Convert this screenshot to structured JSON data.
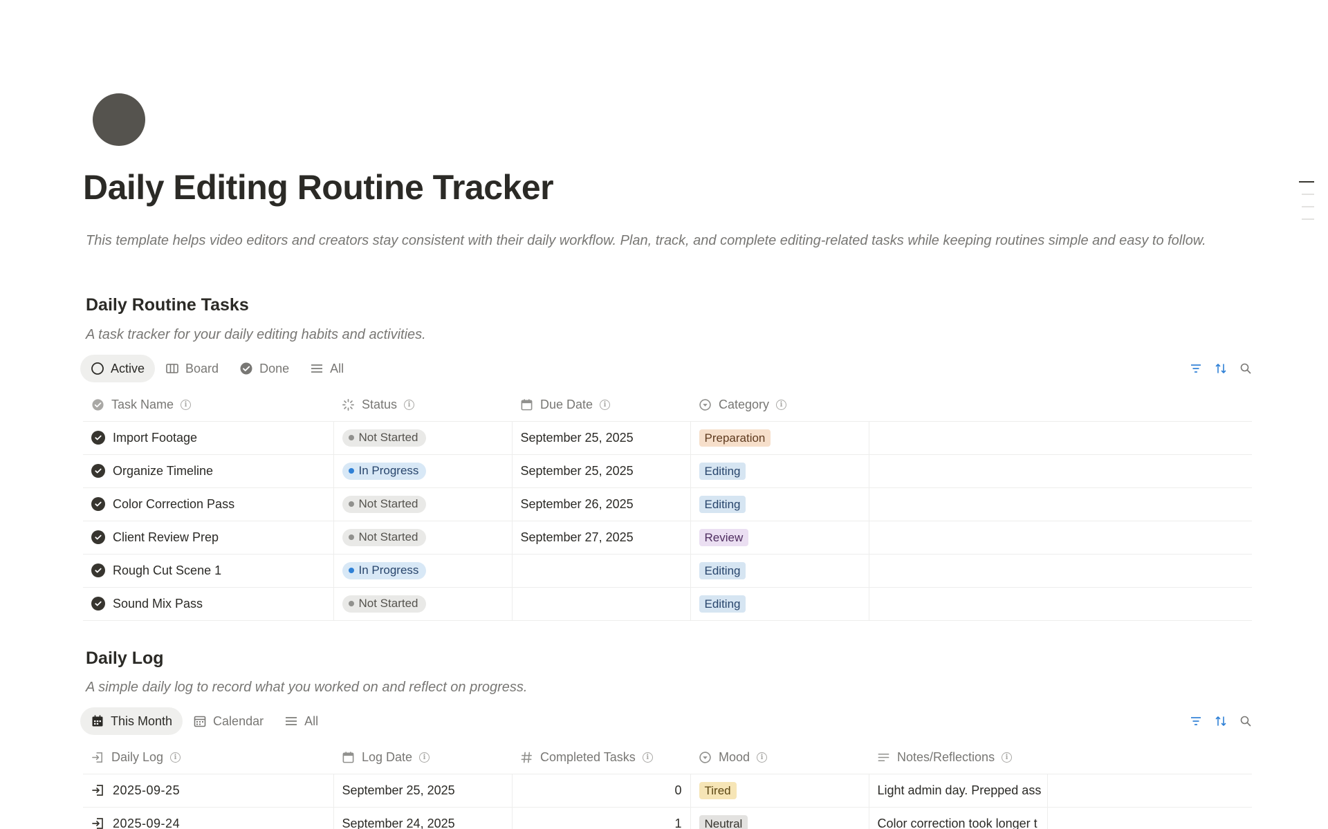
{
  "page": {
    "title": "Daily Editing Routine Tracker",
    "description": "This template helps video editors and creators stay consistent with their daily workflow. Plan, track, and complete editing-related tasks while keeping routines simple and easy to follow."
  },
  "tasks": {
    "title": "Daily Routine Tasks",
    "description": "A task tracker for your daily editing habits and activities.",
    "tabs": [
      "Active",
      "Board",
      "Done",
      "All"
    ],
    "columns": [
      "Task Name",
      "Status",
      "Due Date",
      "Category"
    ],
    "rows": [
      {
        "name": "Import Footage",
        "status": "Not Started",
        "due": "September 25, 2025",
        "category": "Preparation"
      },
      {
        "name": "Organize Timeline",
        "status": "In Progress",
        "due": "September 25, 2025",
        "category": "Editing"
      },
      {
        "name": "Color Correction Pass",
        "status": "Not Started",
        "due": "September 26, 2025",
        "category": "Editing"
      },
      {
        "name": "Client Review Prep",
        "status": "Not Started",
        "due": "September 27, 2025",
        "category": "Review"
      },
      {
        "name": "Rough Cut Scene 1",
        "status": "In Progress",
        "due": "",
        "category": "Editing"
      },
      {
        "name": "Sound Mix Pass",
        "status": "Not Started",
        "due": "",
        "category": "Editing"
      }
    ]
  },
  "log": {
    "title": "Daily Log",
    "description": "A simple daily log to record what you worked on and reflect on progress.",
    "tabs": [
      "This Month",
      "Calendar",
      "All"
    ],
    "columns": [
      "Daily Log",
      "Log Date",
      "Completed Tasks",
      "Mood",
      "Notes/Reflections"
    ],
    "rows": [
      {
        "name": "2025-09-25",
        "date": "September 25, 2025",
        "completed": "0",
        "mood": "Tired",
        "notes": "Light admin day. Prepped ass"
      },
      {
        "name": "2025-09-24",
        "date": "September 24, 2025",
        "completed": "1",
        "mood": "Neutral",
        "notes": "Color correction took longer t"
      }
    ]
  },
  "colors": {
    "status_not_started": "#e9e9e7",
    "status_in_progress": "#d8e8f6",
    "tag_preparation": "#f6dfcb",
    "tag_editing": "#d6e5f2",
    "tag_review": "#ebdff2",
    "mood_tired": "#f6e5b6",
    "mood_neutral": "#e3e2e0",
    "accent_blue": "#2f80d6"
  }
}
